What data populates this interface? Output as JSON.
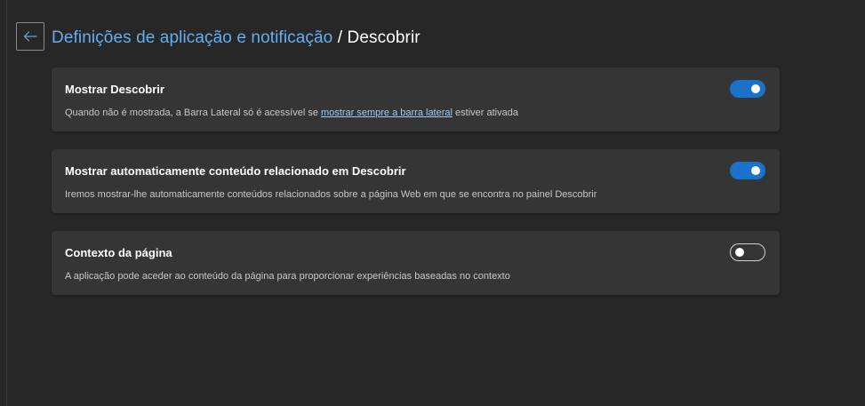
{
  "header": {
    "breadcrumb_parent": "Definições de aplicação e notificação",
    "separator": "/",
    "current": "Descobrir"
  },
  "settings": [
    {
      "title": "Mostrar Descobrir",
      "desc_before": "Quando não é mostrada, a Barra Lateral só é acessível se",
      "desc_link": "mostrar sempre a barra lateral",
      "desc_after": "estiver ativada",
      "enabled": true
    },
    {
      "title": "Mostrar automaticamente conteúdo relacionado em Descobrir",
      "desc": "Iremos mostrar-lhe automaticamente conteúdos relacionados sobre a página Web em que se encontra no painel Descobrir",
      "enabled": true
    },
    {
      "title": "Contexto da página",
      "desc": "A aplicação pode aceder ao conteúdo da página para proporcionar experiências baseadas no contexto",
      "enabled": false
    }
  ],
  "colors": {
    "background": "#272727",
    "card": "#353535",
    "accent": "#1a73c8",
    "link": "#63aef0"
  },
  "icons": {
    "back": "arrow-left-icon"
  }
}
